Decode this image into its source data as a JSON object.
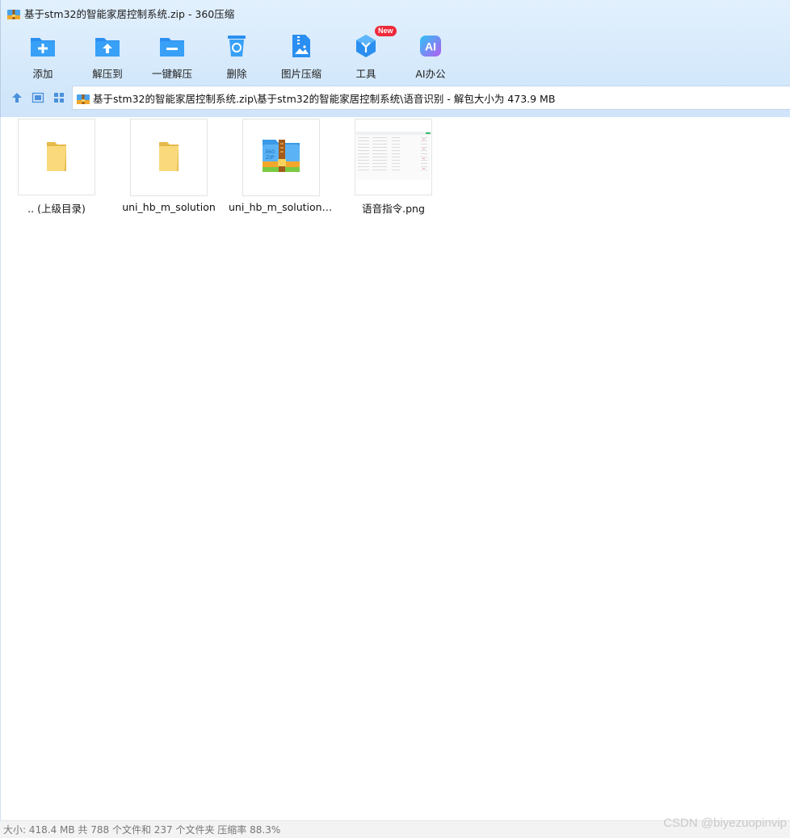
{
  "window": {
    "title": "基于stm32的智能家居控制系统.zip - 360压缩",
    "app_icon": "360zip-archive-icon"
  },
  "toolbar": {
    "items": [
      {
        "label": "添加",
        "icon": "folder-add-icon"
      },
      {
        "label": "解压到",
        "icon": "folder-extract-icon"
      },
      {
        "label": "一键解压",
        "icon": "folder-oneclick-extract-icon"
      },
      {
        "label": "删除",
        "icon": "recycle-bin-icon"
      },
      {
        "label": "图片压缩",
        "icon": "image-compress-icon"
      },
      {
        "label": "工具",
        "icon": "tools-cube-icon",
        "badge": "New"
      },
      {
        "label": "AI办公",
        "icon": "ai-office-icon"
      }
    ]
  },
  "address": {
    "path": "基于stm32的智能家居控制系统.zip\\基于stm32的智能家居控制系统\\语音识别 - 解包大小为 473.9 MB"
  },
  "files": [
    {
      "name": ".. (上级目录)",
      "type": "parent-folder"
    },
    {
      "name": "uni_hb_m_solution",
      "type": "folder"
    },
    {
      "name": "uni_hb_m_solution-9...",
      "type": "archive"
    },
    {
      "name": "语音指令.png",
      "type": "image"
    }
  ],
  "status": {
    "text": "大小: 418.4 MB 共 788 个文件和 237 个文件夹 压缩率 88.3%"
  },
  "watermark": "CSDN @biyezuopinvip",
  "colors": {
    "accent_blue": "#1a8cf0",
    "folder_yellow": "#f7d774",
    "badge_red": "#ee2a3b",
    "chrome_bg": "#d5e9fb"
  }
}
